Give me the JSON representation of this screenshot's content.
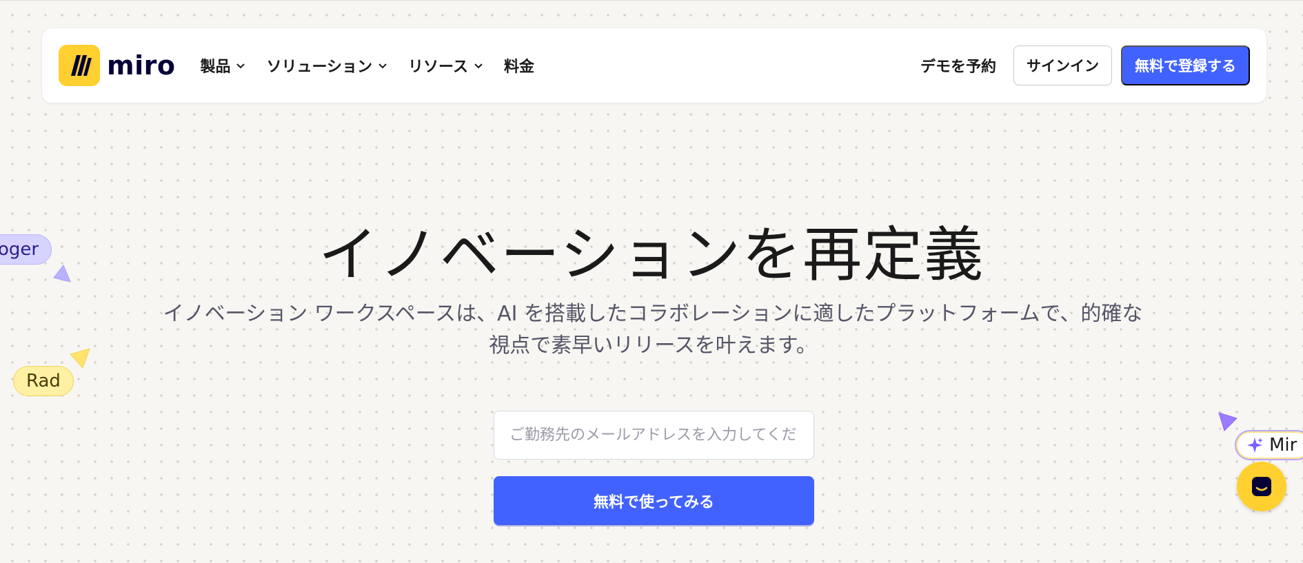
{
  "brand": {
    "name": "miro",
    "logo_color": "#ffd02f"
  },
  "nav": {
    "items": [
      {
        "label": "製品",
        "has_dropdown": true
      },
      {
        "label": "ソリューション",
        "has_dropdown": true
      },
      {
        "label": "リソース",
        "has_dropdown": true
      },
      {
        "label": "料金",
        "has_dropdown": false
      }
    ],
    "demo_label": "デモを予約",
    "signin_label": "サインイン",
    "signup_label": "無料で登録する"
  },
  "hero": {
    "title": "イノベーションを再定義",
    "subtitle": "イノベーション ワークスペースは、AI を搭載したコラボレーションに適したプラットフォームで、的確な視点で素早いリリースを叶えます。",
    "email_placeholder": "ご勤務先のメールアドレスを入力してください",
    "email_value": "",
    "cta_label": "無料で使ってみる"
  },
  "cursors": [
    {
      "name": "oger",
      "color": "#d7d3ff"
    },
    {
      "name": "Rad",
      "color": "#fff0a3"
    }
  ],
  "ai_chip": {
    "label": "Mir",
    "icon": "sparkle-icon"
  },
  "chat": {
    "icon": "chat-icon"
  },
  "colors": {
    "accent": "#4262ff",
    "background": "#f8f6f2"
  }
}
